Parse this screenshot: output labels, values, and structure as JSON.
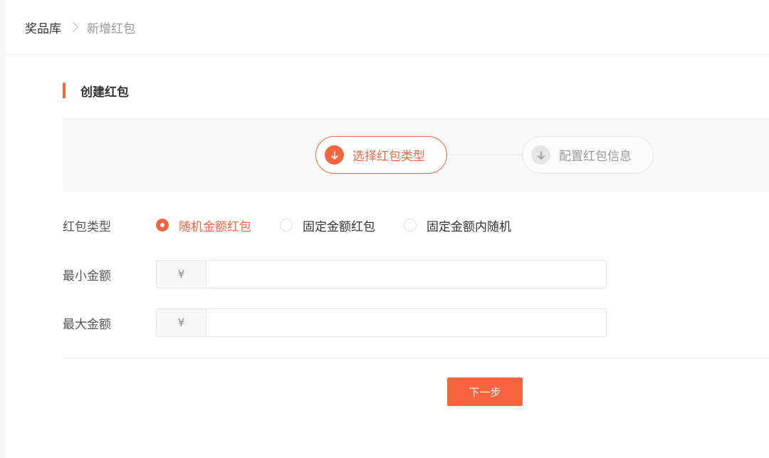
{
  "breadcrumb": {
    "root": "奖品库",
    "current": "新增红包"
  },
  "section": {
    "title": "创建红包"
  },
  "steps": [
    {
      "label": "选择红包类型",
      "state": "active",
      "icon": "arrow-down-icon"
    },
    {
      "label": "配置红包信息",
      "state": "inactive",
      "icon": "arrow-down-icon"
    }
  ],
  "form": {
    "type_label": "红包类型",
    "type_options": [
      {
        "label": "随机金额红包",
        "checked": true
      },
      {
        "label": "固定金额红包",
        "checked": false
      },
      {
        "label": "固定金额内随机",
        "checked": false
      }
    ],
    "min_label": "最小金额",
    "max_label": "最大金额",
    "currency_symbol": "¥",
    "min_value": "",
    "max_value": ""
  },
  "actions": {
    "next_label": "下一步"
  },
  "colors": {
    "accent": "#f7653f",
    "inactive": "#999999"
  }
}
